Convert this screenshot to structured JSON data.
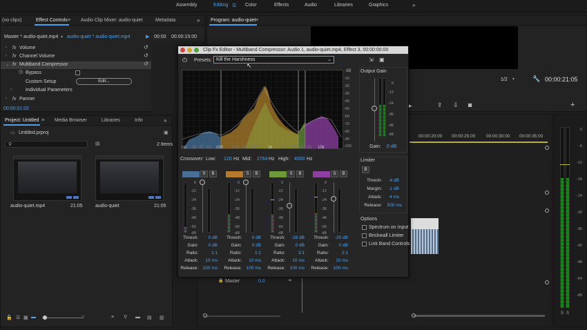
{
  "workspaces": [
    "Assembly",
    "Editing",
    "Color",
    "Effects",
    "Audio",
    "Libraries",
    "Graphics"
  ],
  "workspace_active": "Editing",
  "source_tabs": {
    "no_clips": "(no clips)",
    "effect_controls": "Effect Controls",
    "audio_clip_mixer": "Audio Clip Mixer: audio-quiet",
    "metadata": "Metadata"
  },
  "program_tab": "Program: audio-quiet",
  "effect_controls": {
    "master": "Master * audio-quiet.mp4",
    "clip": "audio-quiet * audio-quiet.mp4",
    "time_start": "00:00",
    "time_end": "00:00:15:00",
    "rows": {
      "volume": "Volume",
      "channel_volume": "Channel Volume",
      "multiband": "Multiband Compressor",
      "bypass": "Bypass",
      "custom_setup": "Custom Setup",
      "edit_button": "Edit...",
      "individual_params": "Individual Parameters",
      "panner": "Panner"
    },
    "timecode": "00:00:01:02"
  },
  "project": {
    "tabs": {
      "project": "Project: Untitled",
      "media_browser": "Media Browser",
      "libraries": "Libraries",
      "info": "Info"
    },
    "file": "Untitled.prproj",
    "items_count": "2 Items",
    "clips": [
      {
        "name": "audio-quiet.mp4",
        "duration": "21:05"
      },
      {
        "name": "audio-quiet",
        "duration": "21:05"
      }
    ]
  },
  "program": {
    "fraction": "1/2",
    "timecode": "00:00:21:05"
  },
  "timeline": {
    "ticks": [
      "00:00:20:00",
      "00:00:25:00",
      "00:00:30:00",
      "00:00:35:00"
    ],
    "master": "Master",
    "master_value": "0.0"
  },
  "dialog": {
    "title": "Clip Fx Editor - Multiband Compressor: Audio 1, audio-quiet.mp4, Effect 3, 00:00:00:00",
    "presets_label": "Presets:",
    "preset_value": "Kill the Harshness",
    "db_label": "dB",
    "db_scale": [
      "-10",
      "-20",
      "-30",
      "-40",
      "-50",
      "-60",
      "-70",
      "-80",
      "-90",
      "-100"
    ],
    "hz_scale": [
      "Hz",
      "30",
      "40",
      "60",
      "100",
      "200",
      "300",
      "500",
      "1k",
      "2k",
      "3k",
      "4k",
      "6k",
      "10k"
    ],
    "crossover": {
      "label": "Crossover:",
      "low_label": "Low:",
      "low_value": "120",
      "low_unit": "Hz",
      "mid_label": "Mid:",
      "mid_value": "2764",
      "mid_unit": "Hz",
      "high_label": "High:",
      "high_value": "4000",
      "high_unit": "Hz"
    },
    "band_scale": [
      "0",
      "-12",
      "-24",
      "-36",
      "-48",
      "-60",
      "dB"
    ],
    "param_labels": {
      "thresh": "Thresh:",
      "gain": "Gain:",
      "ratio": "Ratio:",
      "attack": "Attack:",
      "release": "Release:"
    },
    "bands": [
      {
        "color": "#4a6f97",
        "thresh": "0 dB",
        "gain": "0 dB",
        "ratio": "1:1",
        "attack": "10 ms",
        "release": "100 ms",
        "level": 0.1
      },
      {
        "color": "#b77a2c",
        "thresh": "0 dB",
        "gain": "0 dB",
        "ratio": "1:1",
        "attack": "10 ms",
        "release": "100 ms",
        "level": 0.35
      },
      {
        "color": "#6f9a3a",
        "thresh": "-28 dB",
        "gain": "0 dB",
        "ratio": "3:1",
        "attack": "10 ms",
        "release": "100 ms",
        "level": 0.35
      },
      {
        "color": "#8e3fa1",
        "thresh": "-20 dB",
        "gain": "0 dB",
        "ratio": "2:1",
        "attack": "10 ms",
        "release": "100 ms",
        "level": 0.38
      }
    ],
    "output": {
      "title": "Output Gain",
      "scale": [
        "0",
        "-12",
        "-24",
        "-36",
        "-48",
        "dB"
      ],
      "gain_label": "Gain:",
      "gain_value": "0 dB"
    },
    "limiter": {
      "title": "Limiter",
      "b": "B",
      "thresh_label": "Thresh:",
      "thresh_value": "-4 dB",
      "margin_label": "Margin:",
      "margin_value": "-1 dB",
      "attack_label": "Attack:",
      "attack_value": "4 ms",
      "release_label": "Release:",
      "release_value": "500 ms"
    },
    "options": {
      "title": "Options",
      "spectrum": "Spectrum on Input",
      "brickwall": "Brickwall Limiter",
      "link": "Link Band Controls"
    },
    "s_label": "S",
    "b_label": "B"
  },
  "audio_meter_scale": [
    "0",
    "-6",
    "-12",
    "-18",
    "-24",
    "-30",
    "-36",
    "-42",
    "-48",
    "-54",
    "dB"
  ],
  "audio_meter_s": "S"
}
